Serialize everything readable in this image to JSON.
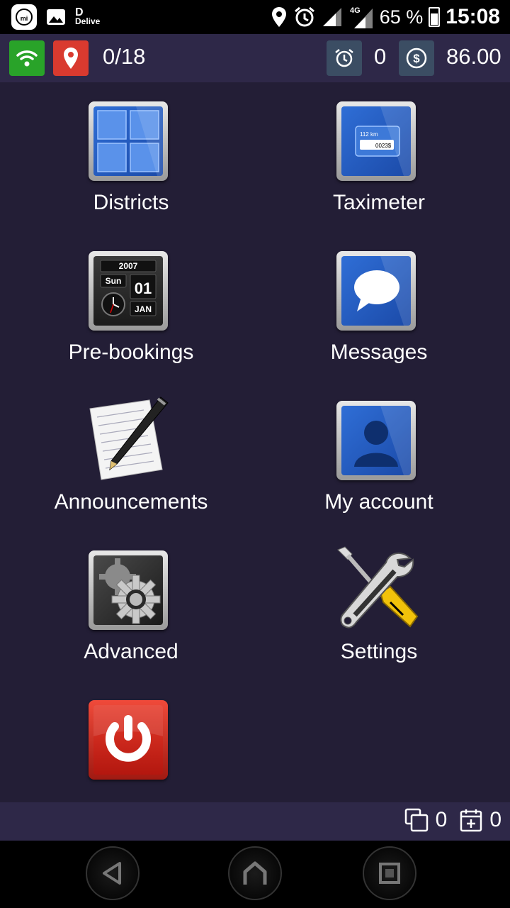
{
  "status_bar": {
    "app_notification": "Delive",
    "battery": "65 %",
    "time": "15:08",
    "network": "4G"
  },
  "top_bar": {
    "orders_count": "0/18",
    "alarm_count": "0",
    "balance": "86.00"
  },
  "menu": {
    "districts": "Districts",
    "taximeter": "Taximeter",
    "taximeter_km": "112 km",
    "taximeter_price": "0023$",
    "prebookings": "Pre-bookings",
    "calendar_year": "2007",
    "calendar_day": "Sun",
    "calendar_date": "01",
    "calendar_month": "JAN",
    "messages": "Messages",
    "announcements": "Announcements",
    "my_account": "My account",
    "advanced": "Advanced",
    "settings": "Settings"
  },
  "bottom_bar": {
    "copies_count": "0",
    "calendar_count": "0"
  },
  "colors": {
    "background": "#231e36",
    "bar": "#2e2848",
    "wifi_green": "#29a329",
    "pin_red": "#d93a2f",
    "accent_slate": "#3b4d63",
    "power_red": "#c81f17"
  }
}
